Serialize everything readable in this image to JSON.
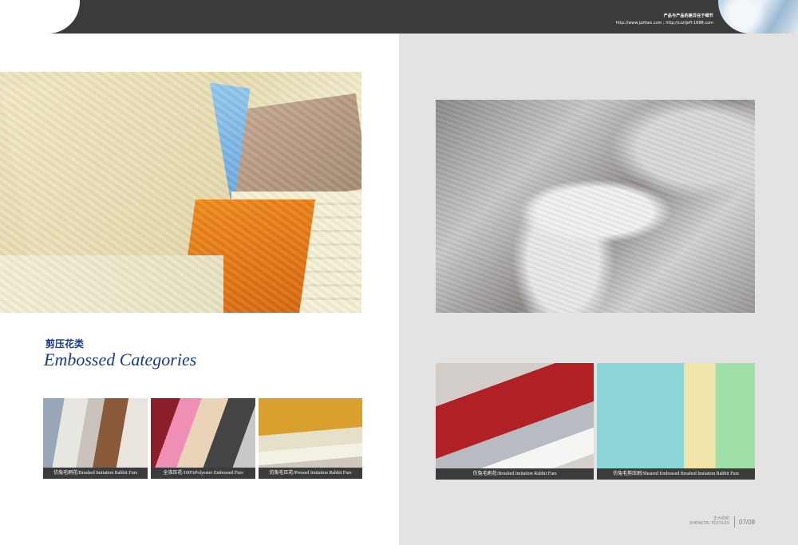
{
  "header": {
    "slogan_cn": "产品与产品的差异在于细节",
    "urls": "http://www.jzzttex.com ; http://czztjeff.1688.com"
  },
  "left_page": {
    "section_title_cn": "剪压花类",
    "section_title_en": "Embossed Categories",
    "thumbnails": [
      {
        "caption": "仿兔毛刷花/Brushed Imitation Rabbit Furs"
      },
      {
        "caption": "全涤压花/100%Polyester Embossed Furs"
      },
      {
        "caption": "仿兔毛压花/Pressed Imitation Rabbit Furs"
      }
    ]
  },
  "right_page": {
    "thumbnails": [
      {
        "caption": "仿兔毛刷花/Brushed Imitation Rabbit Furs"
      },
      {
        "caption": "仿兔毛剪压刷/Sheared Embossed Brushed Imitation Rabbit Furs"
      }
    ]
  },
  "footer": {
    "brand_cn": "正大纺织",
    "brand_en": "ZHENGTAI TEXTILES",
    "page_numbers": "07/08"
  }
}
